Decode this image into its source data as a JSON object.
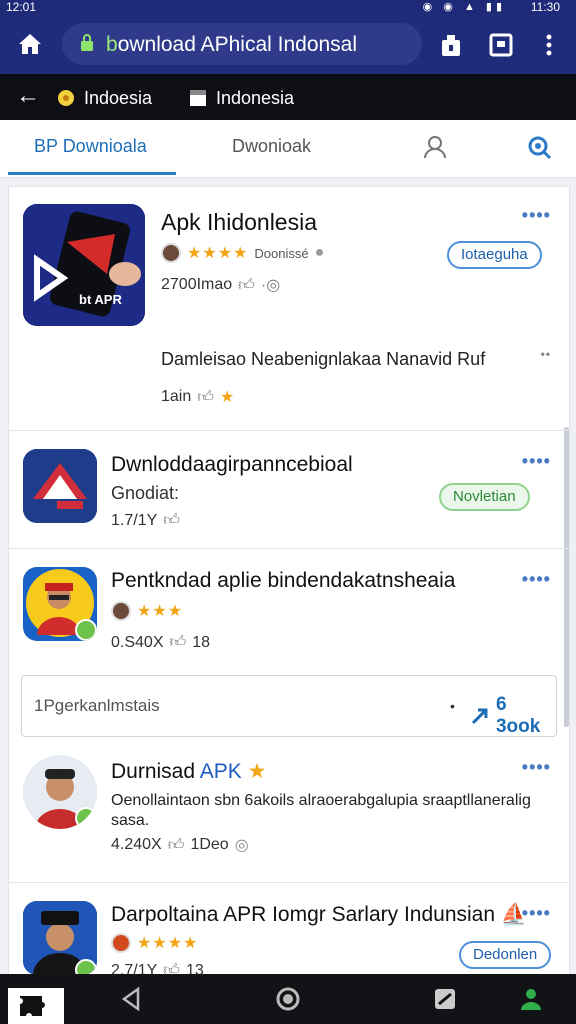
{
  "status": {
    "time_left": "12:01",
    "time_right": "11:30"
  },
  "browser": {
    "url_highlight": "b",
    "url_text": "ownload APhical Indonsal"
  },
  "tabstrip": {
    "back": "←",
    "tab1": "Indoesia",
    "tab2": "Indonesia"
  },
  "subtabs": {
    "tab1": "BP Downioala",
    "tab2": "Dwonioak"
  },
  "items": [
    {
      "title": "Apk Ihidonlesia",
      "rating_label": "Doonissé",
      "stars": "★★★★",
      "downloads": "2700Imao",
      "button": "Iotaeguha",
      "description": "Damleisao Neabenignlakaa Nanavid Ruf",
      "stat": "1ain",
      "icon_text": "bt APR"
    },
    {
      "title": "Dwnloddaagirpanncebioal",
      "subtitle": "Gnodiat:",
      "downloads": "1.7/1Y",
      "button": "Novletian"
    },
    {
      "title": "Pentkndad aplie bindendakatnsheaia",
      "stars": "★★★",
      "downloads": "0.S40X",
      "stat": "18"
    },
    {
      "title_prefix": "Durnisad ",
      "title_blue": "APK",
      "description": "Oenollaintaon sbn 6akoils alraoerabgalupia sraaptllaneralig sasa.",
      "downloads": "4.240X",
      "stat": "1Deo"
    },
    {
      "title": "Darpoltaina APR Iomgr Sarlary Indunsian",
      "stars": "★★★★",
      "downloads": "2.7/1Y",
      "stat": "13",
      "button": "Dedonlen"
    }
  ],
  "search": {
    "placeholder": "1Pgerkanlmstais",
    "dot": "•",
    "go_label": "6 3ook"
  },
  "more": "••••",
  "colors": {
    "browser_bar": "#1f2b7b",
    "accent_blue": "#2b7cc7",
    "star": "#f2a414",
    "green": "#6cc24a"
  }
}
